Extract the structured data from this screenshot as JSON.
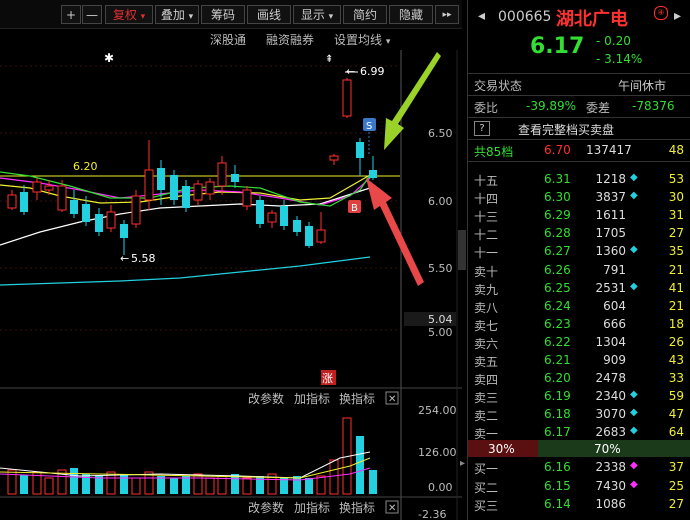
{
  "toolbar": {
    "plus": "+",
    "minus": "—",
    "fuquan": "复权",
    "diejia": "叠加",
    "chouma": "筹码",
    "huaxian": "画线",
    "xianshi": "显示",
    "jianyue": "简约",
    "yincang": "隐藏",
    "more": "▸▸"
  },
  "subbar": {
    "shengutong": "深股通",
    "rongzi": "融资融券",
    "junxian": "设置均线"
  },
  "chart": {
    "y_labels": [
      "6.50",
      "6.00",
      "5.50",
      "5.04",
      "5.00"
    ],
    "high_label": "6.99",
    "low_label": "5.58",
    "mid_label": "6.20",
    "marker_s": "S",
    "marker_b": "B",
    "limit_up": "涨",
    "vol_labels": [
      "254.00",
      "126.00",
      "0.00",
      "-2.36"
    ],
    "vol_toolbar": {
      "gaicanshu": "改参数",
      "jiazhibiao": "加指标",
      "huanzhibiao": "换指标",
      "close": "✕"
    },
    "vol_toolbar2": {
      "gaicanshu": "改参数",
      "jiazhibiao": "加指标",
      "huanzhibiao": "换指标",
      "close": "✕"
    },
    "colors": {
      "up": "#ff3030",
      "down": "#22d0e0",
      "ma5": "#ffffff",
      "ma10": "#f0f030",
      "ma20": "#ff30ff",
      "ma60": "#33dd33"
    }
  },
  "stock": {
    "code": "000665",
    "name": "湖北广电",
    "price": "6.17",
    "change": "- 0.20",
    "pct": "- 3.14%",
    "status_label": "交易状态",
    "status_value": "午间休市",
    "weibi_label": "委比",
    "weibi_value": "-39.89%",
    "weicha_label": "委差",
    "weicha_value": "-78376",
    "full_book": "查看完整档买卖盘",
    "total_label": "共85档",
    "total_price": "6.70",
    "total_vol": "137417",
    "total_cnt": "48",
    "sell_pct": "30%",
    "buy_pct": "70%"
  },
  "asks": [
    {
      "level": "十五",
      "price": "6.31",
      "vol": "1218",
      "mark": "◆",
      "cnt": "53"
    },
    {
      "level": "十四",
      "price": "6.30",
      "vol": "3837",
      "mark": "◆",
      "cnt": "30"
    },
    {
      "level": "十三",
      "price": "6.29",
      "vol": "1611",
      "mark": "",
      "cnt": "31"
    },
    {
      "level": "十二",
      "price": "6.28",
      "vol": "1705",
      "mark": "",
      "cnt": "27"
    },
    {
      "level": "十一",
      "price": "6.27",
      "vol": "1360",
      "mark": "◆",
      "cnt": "35"
    },
    {
      "level": "卖十",
      "price": "6.26",
      "vol": "791",
      "mark": "",
      "cnt": "21"
    },
    {
      "level": "卖九",
      "price": "6.25",
      "vol": "2531",
      "mark": "◆",
      "cnt": "41"
    },
    {
      "level": "卖八",
      "price": "6.24",
      "vol": "604",
      "mark": "",
      "cnt": "21"
    },
    {
      "level": "卖七",
      "price": "6.23",
      "vol": "666",
      "mark": "",
      "cnt": "18"
    },
    {
      "level": "卖六",
      "price": "6.22",
      "vol": "1304",
      "mark": "",
      "cnt": "26"
    },
    {
      "level": "卖五",
      "price": "6.21",
      "vol": "909",
      "mark": "",
      "cnt": "43"
    },
    {
      "level": "卖四",
      "price": "6.20",
      "vol": "2478",
      "mark": "",
      "cnt": "33"
    },
    {
      "level": "卖三",
      "price": "6.19",
      "vol": "2340",
      "mark": "◆",
      "cnt": "59"
    },
    {
      "level": "卖二",
      "price": "6.18",
      "vol": "3070",
      "mark": "◆",
      "cnt": "47"
    },
    {
      "level": "卖一",
      "price": "6.17",
      "vol": "2683",
      "mark": "◆",
      "cnt": "64"
    }
  ],
  "bids": [
    {
      "level": "买一",
      "price": "6.16",
      "vol": "2338",
      "mark": "◆",
      "cnt": "37"
    },
    {
      "level": "买二",
      "price": "6.15",
      "vol": "7430",
      "mark": "◆",
      "cnt": "25"
    },
    {
      "level": "买三",
      "price": "6.14",
      "vol": "1086",
      "mark": "",
      "cnt": "27"
    }
  ]
}
